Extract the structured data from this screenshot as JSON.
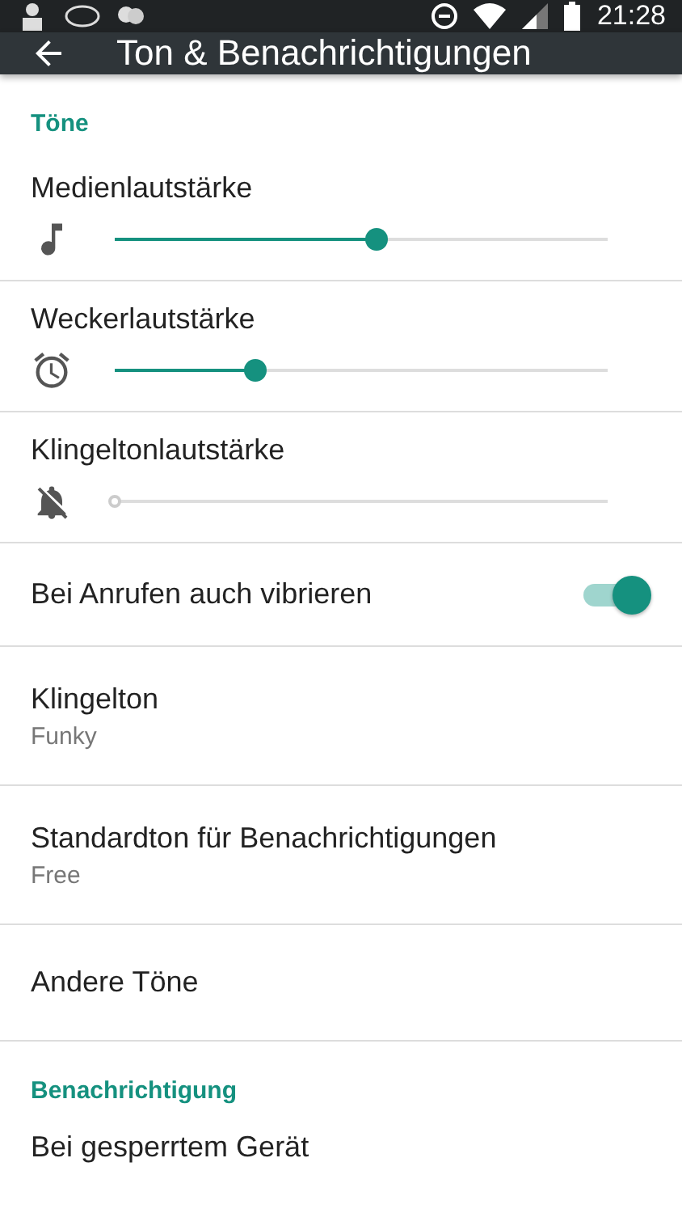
{
  "status_bar": {
    "time": "21:28"
  },
  "toolbar": {
    "title": "Ton & Benachrichtigungen"
  },
  "sections": [
    {
      "header": "Töne",
      "items": [
        {
          "kind": "slider",
          "title": "Medienlautstärke",
          "level": 0.53,
          "disabled": false
        },
        {
          "kind": "slider",
          "title": "Weckerlautstärke",
          "level": 0.285,
          "disabled": false
        },
        {
          "kind": "slider",
          "title": "Klingeltonlautstärke",
          "level": 0,
          "disabled": true
        },
        {
          "kind": "switch",
          "title": "Bei Anrufen auch vibrieren",
          "on": true
        },
        {
          "kind": "text",
          "title": "Klingelton",
          "summary": "Funky"
        },
        {
          "kind": "text",
          "title": "Standardton für Benachrichtigungen",
          "summary": "Free"
        },
        {
          "kind": "text",
          "title": "Andere Töne"
        }
      ]
    },
    {
      "header": "Benachrichtigung",
      "items": [
        {
          "kind": "text",
          "title": "Bei gesperrtem Gerät"
        }
      ]
    }
  ]
}
